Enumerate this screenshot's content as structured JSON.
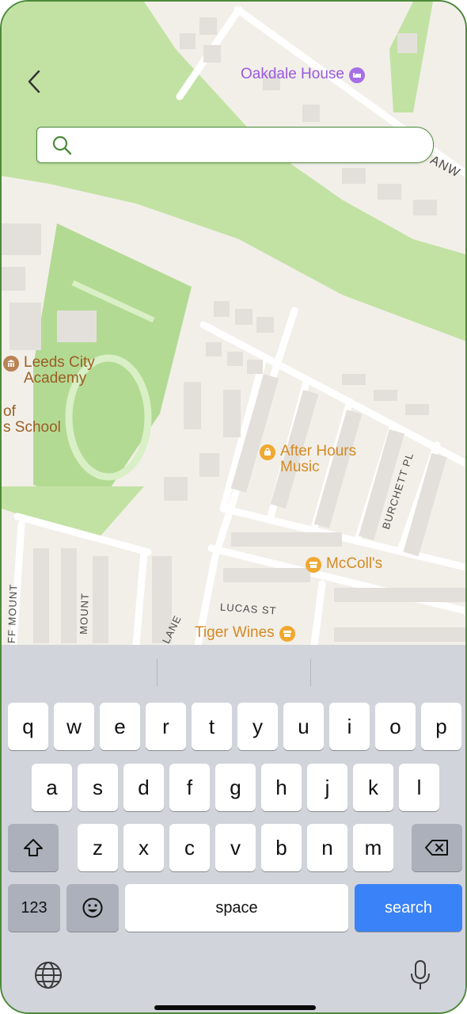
{
  "search": {
    "value": "",
    "placeholder": ""
  },
  "map": {
    "pois": [
      {
        "name": "Oakdale House",
        "kind": "hotel"
      },
      {
        "name": "Leeds City Academy",
        "kind": "school"
      },
      {
        "name": "After Hours Music",
        "kind": "shop"
      },
      {
        "name": "McColl's",
        "kind": "shop"
      },
      {
        "name": "Tiger Wines",
        "kind": "shop"
      }
    ],
    "fragments": {
      "school_left": "of\ns School"
    },
    "streets": {
      "burchett_pl": "BURCHETT PL",
      "lucas_st": "LUCAS ST",
      "lane": "LANE",
      "mount_left": "FF MOUNT",
      "mount_right": "MOUNT",
      "top_right": "ANW"
    }
  },
  "keyboard": {
    "row1": [
      "q",
      "w",
      "e",
      "r",
      "t",
      "y",
      "u",
      "i",
      "o",
      "p"
    ],
    "row2": [
      "a",
      "s",
      "d",
      "f",
      "g",
      "h",
      "j",
      "k",
      "l"
    ],
    "row3": [
      "z",
      "x",
      "c",
      "v",
      "b",
      "n",
      "m"
    ],
    "numbers_label": "123",
    "space_label": "space",
    "search_label": "search",
    "icons": [
      "shift-icon",
      "delete-icon",
      "emoji-icon",
      "globe-icon",
      "microphone-icon"
    ]
  },
  "colors": {
    "accent": "#4d8a3a",
    "search_key": "#3a82f7",
    "map_green": "#c2e2a3",
    "poi_orange": "#d48a23"
  }
}
